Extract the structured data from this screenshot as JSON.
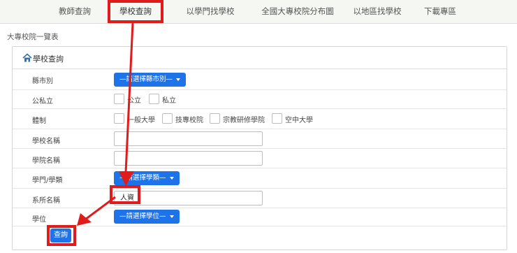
{
  "nav": {
    "items": [
      {
        "label": "教師查詢"
      },
      {
        "label": "學校查詢"
      },
      {
        "label": "以學門找學校"
      },
      {
        "label": "全國大專校院分布圖"
      },
      {
        "label": "以地區找學校"
      },
      {
        "label": "下載專區"
      }
    ],
    "active_index": 1
  },
  "breadcrumb": "大專校院一覽表",
  "panel": {
    "title": "學校查詢",
    "title_icon": "home-icon"
  },
  "form": {
    "city": {
      "label": "縣市別",
      "button": "—請選擇縣市別—"
    },
    "ownership": {
      "label": "公私立",
      "options": [
        "公立",
        "私立"
      ]
    },
    "system": {
      "label": "體制",
      "options": [
        "一般大學",
        "技專校院",
        "宗教研修學院",
        "空中大學"
      ]
    },
    "school_name": {
      "label": "學校名稱",
      "value": ""
    },
    "college_name": {
      "label": "學院名稱",
      "value": ""
    },
    "field": {
      "label": "學門/學類",
      "button": "—請選擇學類—"
    },
    "dept_name": {
      "label": "系所名稱",
      "value": "人資"
    },
    "degree": {
      "label": "學位",
      "button": "—請選擇學位—"
    },
    "submit_label": "查詢"
  },
  "colors": {
    "accent": "#1e73e8",
    "annotation": "#e01b1b",
    "nav_background": "#f4f7f2"
  }
}
